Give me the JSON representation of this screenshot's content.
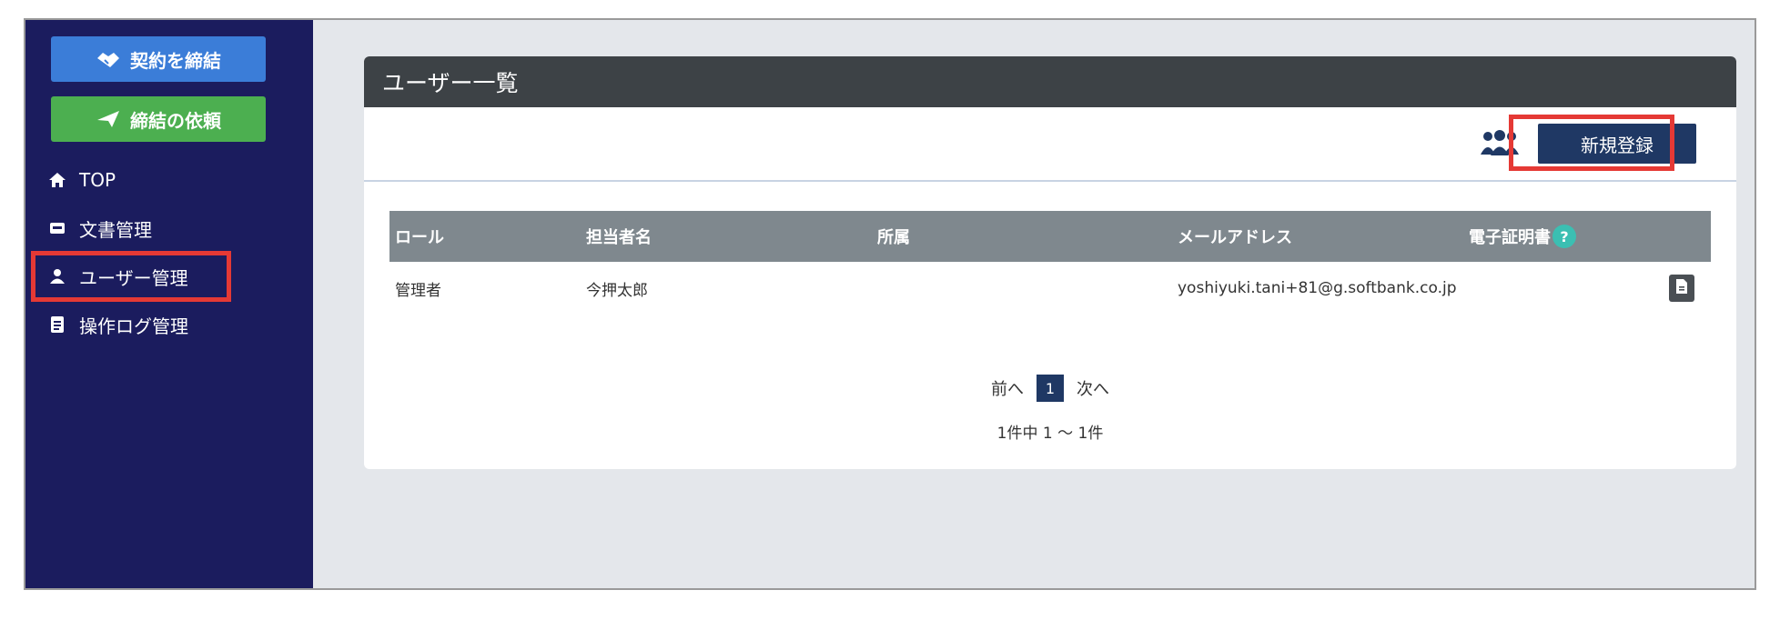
{
  "sidebar": {
    "contract_button": "契約を締結",
    "request_button": "締結の依頼",
    "items": [
      {
        "label": "TOP",
        "icon": "home-icon"
      },
      {
        "label": "文書管理",
        "icon": "document-icon"
      },
      {
        "label": "ユーザー管理",
        "icon": "user-icon"
      },
      {
        "label": "操作ログ管理",
        "icon": "log-icon"
      }
    ]
  },
  "main": {
    "title": "ユーザー一覧",
    "new_button": "新規登録",
    "table": {
      "headers": [
        "ロール",
        "担当者名",
        "所属",
        "メールアドレス",
        "電子証明書"
      ],
      "rows": [
        {
          "role": "管理者",
          "name": "今押太郎",
          "affiliation": "",
          "email": "yoshiyuki.tani+81@g.softbank.co.jp"
        }
      ]
    },
    "pagination": {
      "prev": "前へ",
      "current": "1",
      "next": "次へ",
      "summary": "1件中 1 ～ 1件"
    },
    "help_label": "?"
  },
  "colors": {
    "sidebar_bg": "#1b1c5e",
    "contract_button": "#3b7dd8",
    "request_button": "#4caf50",
    "header_bg": "#3d4246",
    "primary_button": "#1f3864",
    "highlight": "#e53935"
  }
}
